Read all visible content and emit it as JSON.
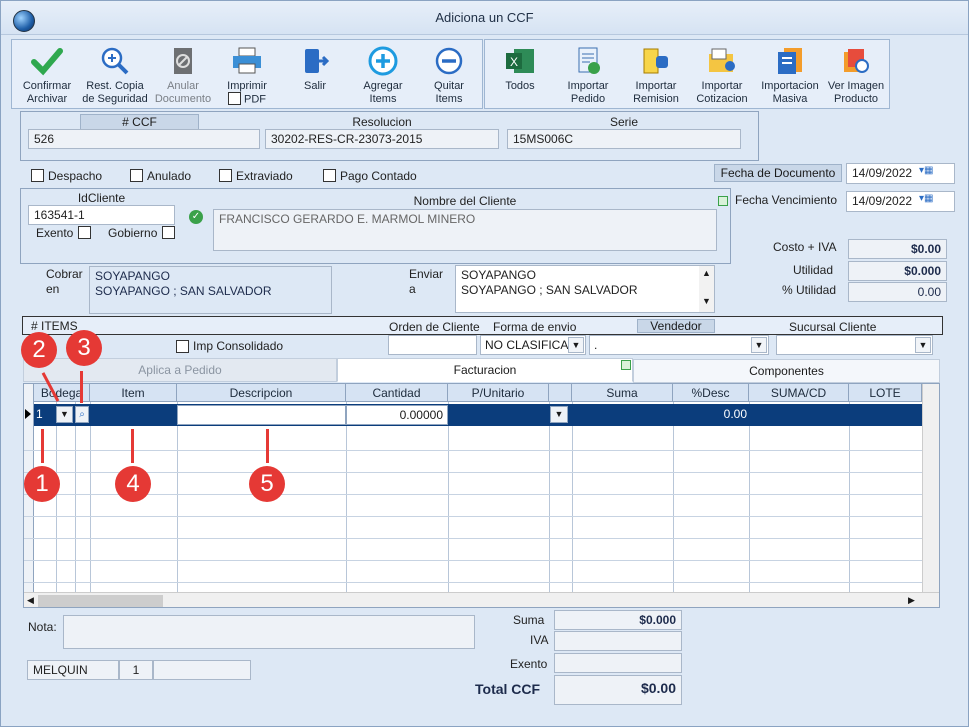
{
  "window": {
    "title": "Adiciona un CCF"
  },
  "toolbar": {
    "confirm": "Confirmar\nArchivar",
    "restore": "Rest. Copia\nde Seguridad",
    "void": "Anular\nDocumento",
    "print": "Imprimir",
    "pdf": "PDF",
    "exit": "Salir",
    "add": "Agregar\nItems",
    "remove": "Quitar\nItems",
    "all": "Todos",
    "imp_order": "Importar\nPedido",
    "imp_remit": "Importar\nRemision",
    "imp_quote": "Importar\nCotizacion",
    "imp_mass": "Importacion\nMasiva",
    "view_img": "Ver Imagen\nProducto"
  },
  "doc": {
    "ccf_label": "# CCF",
    "ccf": "526",
    "res_label": "Resolucion",
    "res": "30202-RES-CR-23073-2015",
    "serie_label": "Serie",
    "serie": "15MS006C"
  },
  "flags": {
    "despacho": "Despacho",
    "anulado": "Anulado",
    "extraviado": "Extraviado",
    "pago": "Pago Contado"
  },
  "dates": {
    "fecha_doc_label": "Fecha de  Documento",
    "fecha_doc": "14/09/2022",
    "fecha_venc_label": "Fecha Vencimiento",
    "fecha_venc": "14/09/2022"
  },
  "client": {
    "id_label": "IdCliente",
    "id": "163541-1",
    "exento": "Exento",
    "gobierno": "Gobierno",
    "name_label": "Nombre del Cliente",
    "name": "FRANCISCO GERARDO E. MARMOL MINERO"
  },
  "costs": {
    "costo_label": "Costo + IVA",
    "costo": "$0.00",
    "util_label": "Utilidad",
    "util": "$0.000",
    "putil_label": "% Utilidad",
    "putil": "0.00"
  },
  "address": {
    "cobrar_label": "Cobrar\nen",
    "cobrar": "SOYAPANGO\nSOYAPANGO ; SAN SALVADOR",
    "enviar_label": "Enviar\na",
    "enviar": "SOYAPANGO\nSOYAPANGO ; SAN SALVADOR"
  },
  "order": {
    "items_label": "# ITEMS",
    "orden_label": "Orden de Cliente",
    "forma_label": "Forma de envio",
    "vendedor_label": "Vendedor",
    "sucursal_label": "Sucursal Cliente",
    "imp_consol": "Imp Consolidado",
    "forma": "NO CLASIFICAD",
    "vendedor": "."
  },
  "tabs": [
    "Aplica a Pedido",
    "Facturacion",
    "Componentes"
  ],
  "grid": {
    "headers": [
      "Bodega",
      "Item",
      "Descripcion",
      "Cantidad",
      "P/Unitario",
      "Suma",
      "%Desc",
      "SUMA/CD",
      "LOTE"
    ],
    "row": {
      "bodega": "1",
      "cantidad": "0.00000",
      "desc": "0.00"
    }
  },
  "markers": [
    "1",
    "2",
    "3",
    "4",
    "5"
  ],
  "footer": {
    "nota_label": "Nota:",
    "user": "MELQUIN",
    "num": "1",
    "suma_label": "Suma",
    "suma": "$0.000",
    "iva_label": "IVA",
    "exento_label": "Exento",
    "total_label": "Total CCF",
    "total": "$0.00"
  }
}
